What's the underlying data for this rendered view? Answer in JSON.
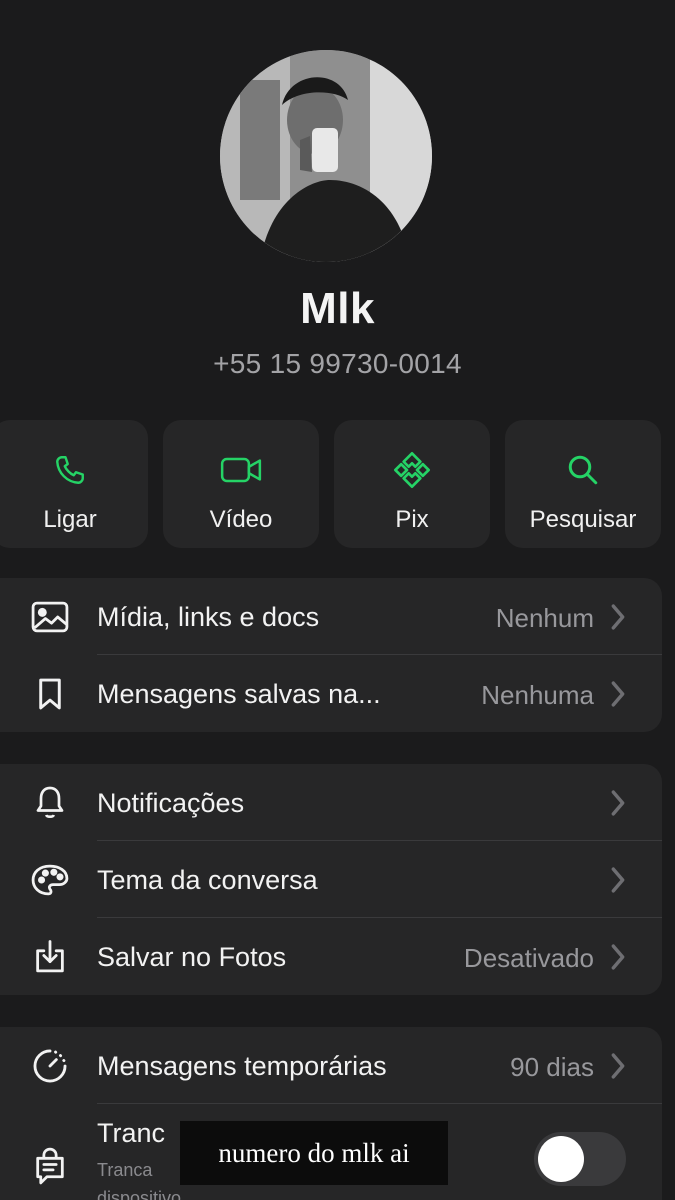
{
  "contact": {
    "name": "Mlk",
    "phone": "+55 15 99730-0014"
  },
  "actions": [
    {
      "label": "Ligar",
      "icon": "phone-icon"
    },
    {
      "label": "Vídeo",
      "icon": "video-icon"
    },
    {
      "label": "Pix",
      "icon": "pix-icon"
    },
    {
      "label": "Pesquisar",
      "icon": "search-icon"
    }
  ],
  "media_group": {
    "media": {
      "label": "Mídia, links e docs",
      "value": "Nenhum",
      "icon": "image-icon"
    },
    "saved": {
      "label": "Mensagens salvas na...",
      "value": "Nenhuma",
      "icon": "bookmark-icon"
    }
  },
  "settings_group": {
    "notifications": {
      "label": "Notificações",
      "icon": "bell-icon"
    },
    "theme": {
      "label": "Tema da conversa",
      "icon": "palette-icon"
    },
    "save_photos": {
      "label": "Salvar no Fotos",
      "value": "Desativado",
      "icon": "download-icon"
    }
  },
  "privacy_group": {
    "disappearing": {
      "label": "Mensagens temporárias",
      "value": "90 dias",
      "icon": "timer-icon"
    },
    "lock": {
      "label": "Tranc",
      "sub_line1": "Tranca",
      "sub_line2": "dispositivo.",
      "icon": "lock-chat-icon",
      "toggle_on": false
    }
  },
  "caption": "numero do mlk ai",
  "colors": {
    "accent": "#25d366",
    "background": "#1b1b1c",
    "card": "#262627",
    "secondary_text": "#98989c"
  }
}
